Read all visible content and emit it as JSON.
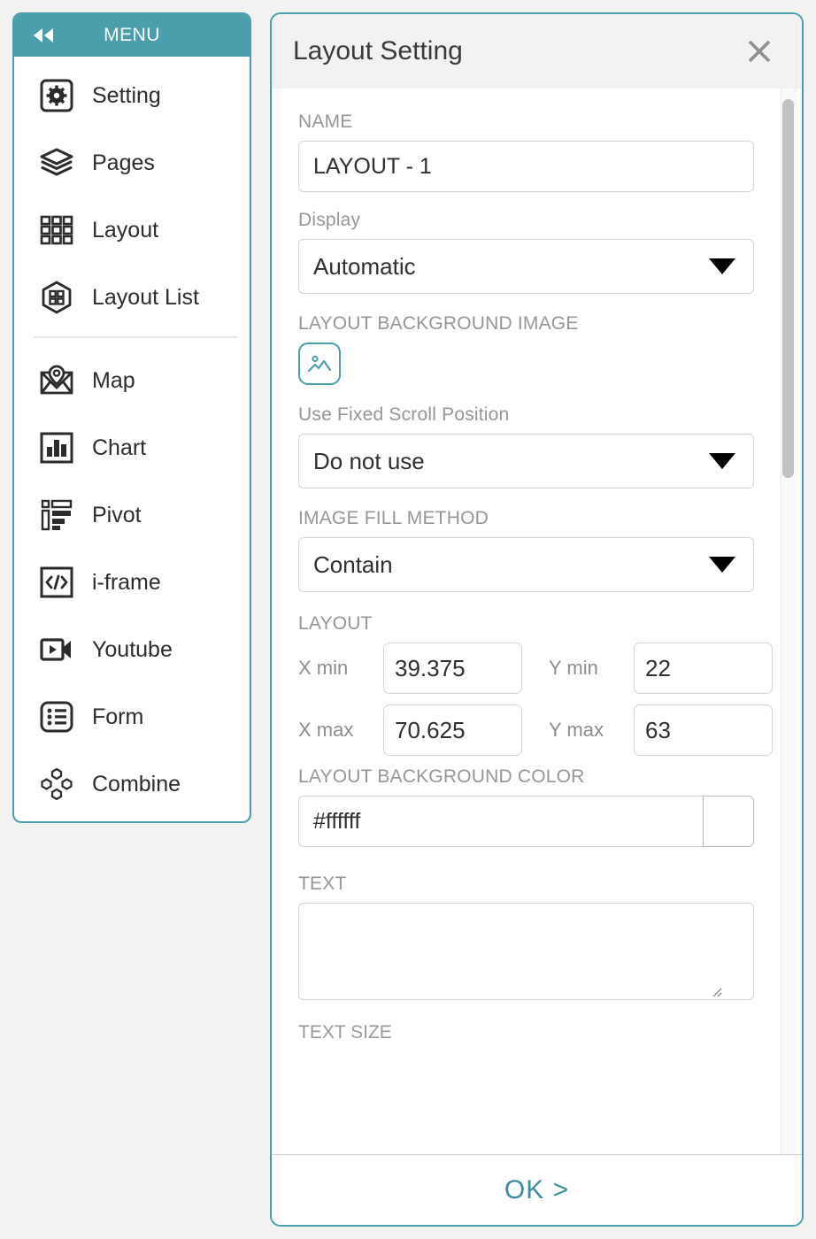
{
  "theme": {
    "accent": "#4b9fad",
    "page_bg": "#f2f2f0",
    "header_bg": "#f2f2f2",
    "label_gray": "#969696",
    "ok_color": "#3c8d9c"
  },
  "sidebar": {
    "header": {
      "title": "MENU",
      "collapse_icon": "double-chevron-left-icon"
    },
    "groups": [
      {
        "items": [
          {
            "label": "Setting",
            "icon": "gear-icon"
          },
          {
            "label": "Pages",
            "icon": "layers-icon"
          },
          {
            "label": "Layout",
            "icon": "grid-icon"
          },
          {
            "label": "Layout List",
            "icon": "hexagon-grid-icon"
          }
        ]
      },
      {
        "items": [
          {
            "label": "Map",
            "icon": "map-pin-icon"
          },
          {
            "label": "Chart",
            "icon": "bar-chart-icon"
          },
          {
            "label": "Pivot",
            "icon": "pivot-table-icon"
          },
          {
            "label": "i-frame",
            "icon": "code-brackets-icon"
          },
          {
            "label": "Youtube",
            "icon": "video-camera-icon"
          },
          {
            "label": "Form",
            "icon": "list-form-icon"
          },
          {
            "label": "Combine",
            "icon": "combine-nodes-icon"
          }
        ]
      }
    ]
  },
  "dialog": {
    "title": "Layout Setting",
    "close_icon": "close-icon",
    "fields": {
      "name": {
        "label": "NAME",
        "value": "LAYOUT - 1",
        "placeholder": ""
      },
      "display": {
        "label": "Display",
        "value": "Automatic",
        "options": [
          "Automatic"
        ]
      },
      "background_image": {
        "label": "LAYOUT BACKGROUND IMAGE",
        "icon": "image-picker-icon"
      },
      "fixed_scroll": {
        "label": "Use Fixed Scroll Position",
        "value": "Do not use",
        "options": [
          "Do not use"
        ]
      },
      "image_fill": {
        "label": "IMAGE FILL METHOD",
        "value": "Contain",
        "options": [
          "Contain"
        ]
      },
      "layout": {
        "label": "LAYOUT",
        "x_min_label": "X min",
        "x_min_value": "39.375",
        "y_min_label": "Y min",
        "y_min_value": "22",
        "x_max_label": "X max",
        "x_max_value": "70.625",
        "y_max_label": "Y max",
        "y_max_value": "63"
      },
      "background_color": {
        "label": "LAYOUT BACKGROUND COLOR",
        "value": "#ffffff",
        "swatch": "#ffffff"
      },
      "text": {
        "label": "TEXT",
        "value": "",
        "placeholder": ""
      },
      "text_size": {
        "label": "TEXT SIZE"
      }
    },
    "footer": {
      "ok_label": "OK >"
    },
    "scrollbar": {
      "name": "vertical-scrollbar"
    }
  }
}
